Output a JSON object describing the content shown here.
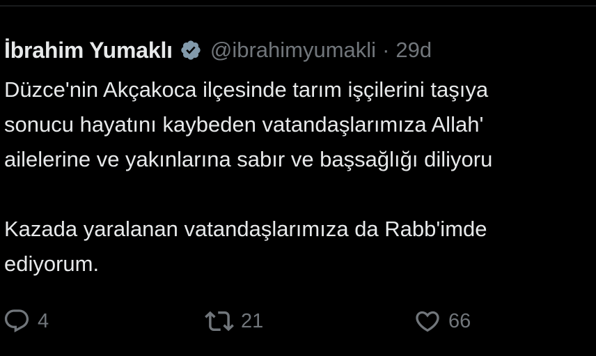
{
  "colors": {
    "background": "#000000",
    "text_primary": "#e7e9ea",
    "text_secondary": "#71767b",
    "divider": "#2f3336",
    "badge": "#829aab"
  },
  "tweet": {
    "author": {
      "display_name": "İbrahim Yumaklı",
      "handle": "@ibrahimyumakli",
      "verified_badge_icon": "verified-check-icon"
    },
    "separator": "·",
    "time_ago": "29d",
    "body_lines": [
      "Düzce'nin Akçakoca ilçesinde tarım işçilerini taşıya",
      "sonucu hayatını kaybeden vatandaşlarımıza Allah'",
      "ailelerine ve yakınlarına sabır ve başsağlığı diliyoru",
      "",
      "Kazada yaralanan vatandaşlarımıza da Rabb'imde",
      "ediyorum."
    ],
    "actions": {
      "reply": {
        "icon": "reply-icon",
        "count": "4"
      },
      "retweet": {
        "icon": "retweet-icon",
        "count": "21"
      },
      "like": {
        "icon": "heart-icon",
        "count": "66"
      }
    }
  }
}
